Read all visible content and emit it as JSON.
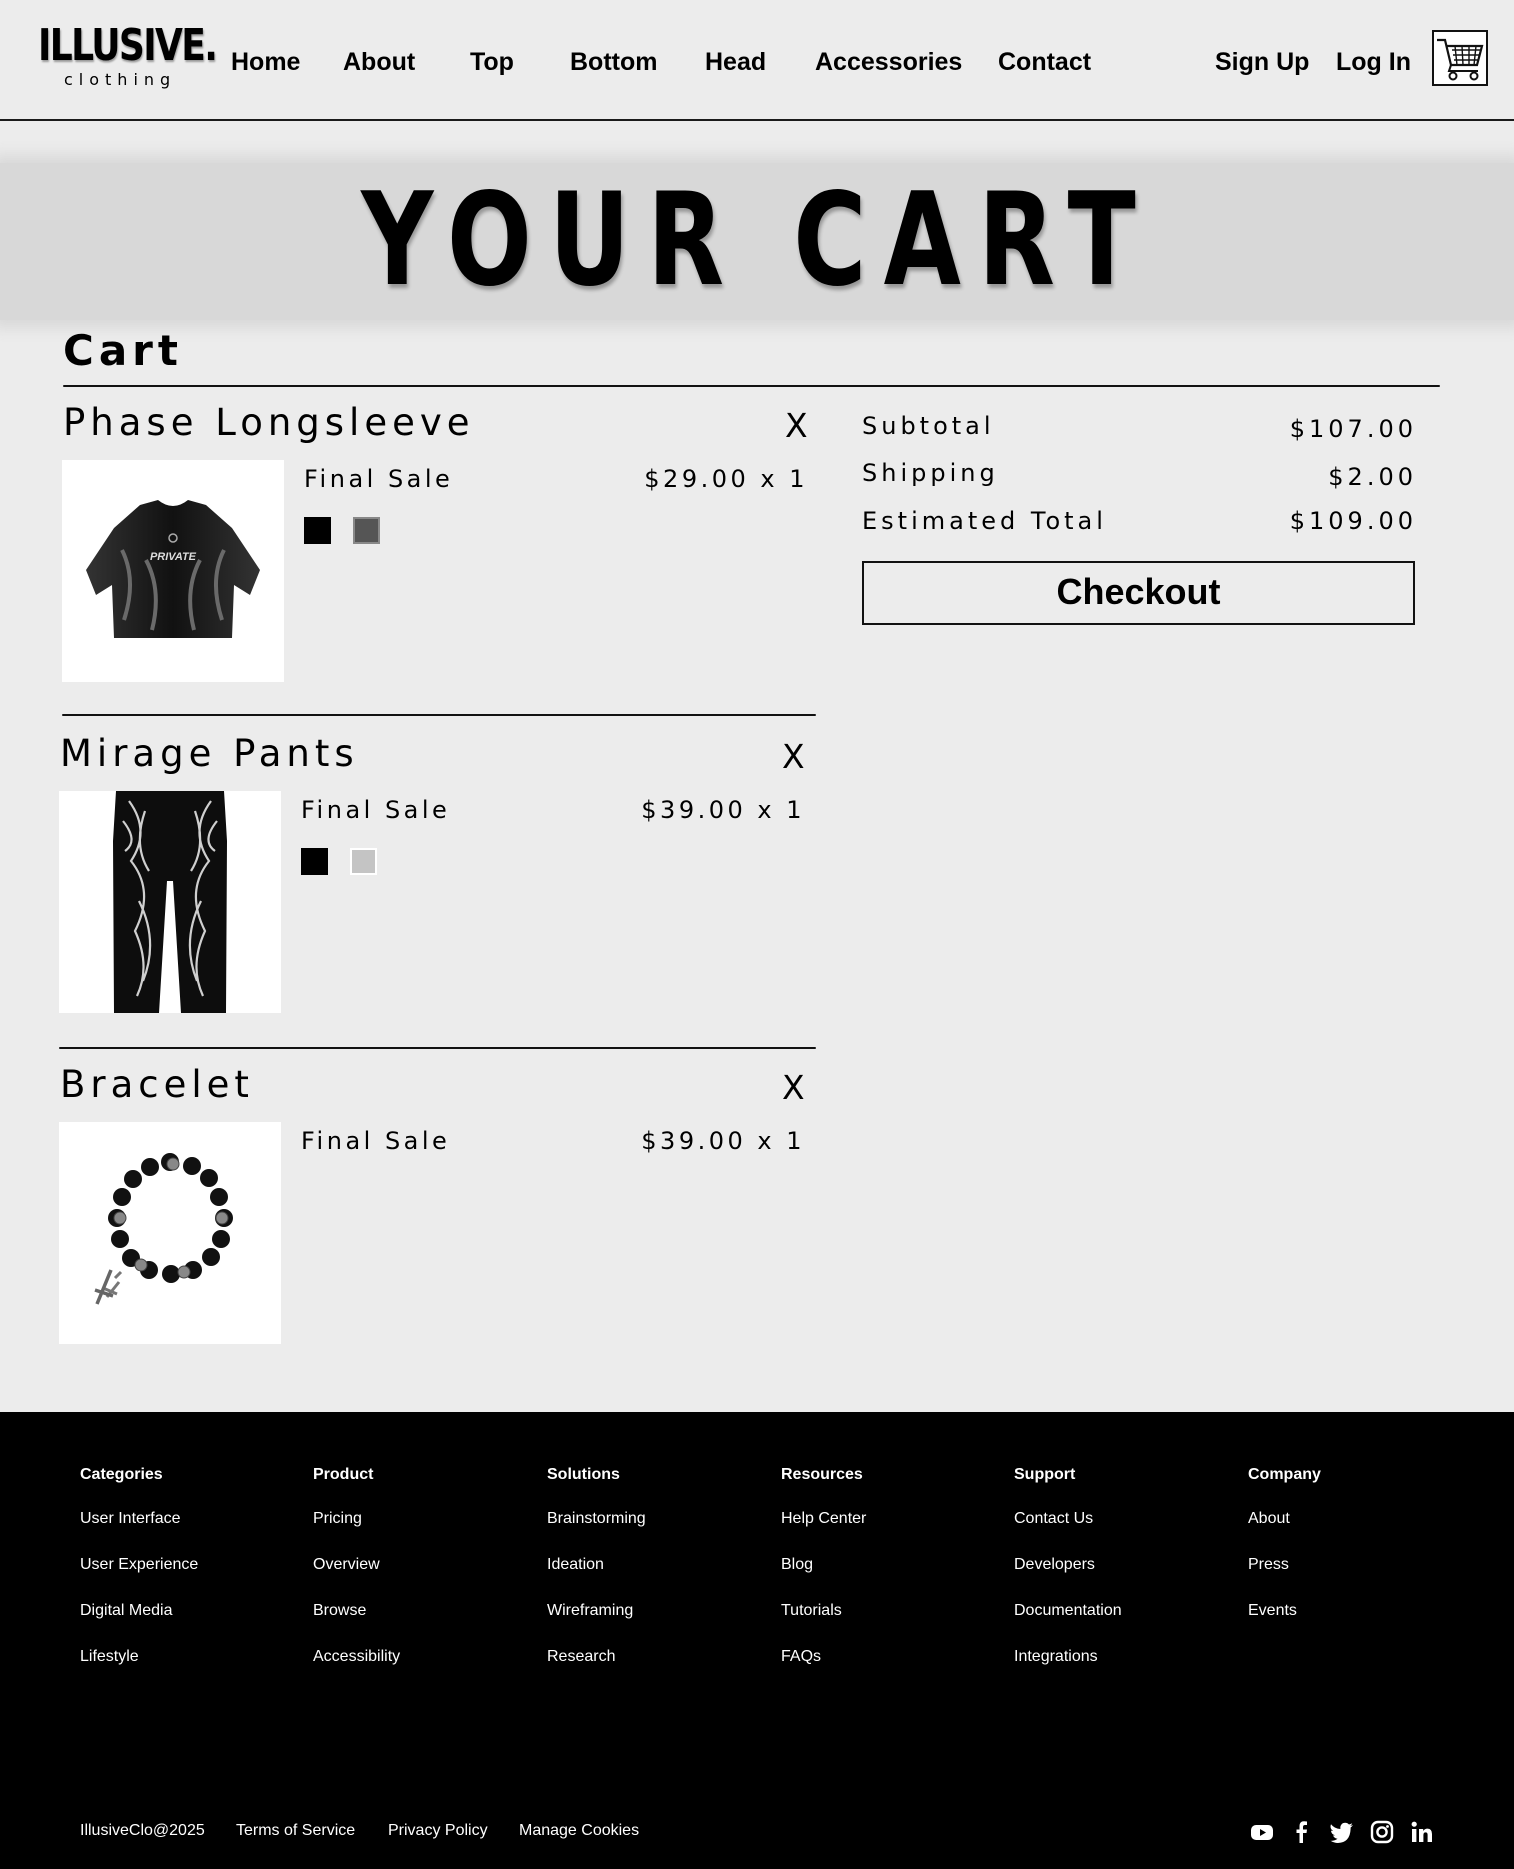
{
  "brand": {
    "name": "ILLUSIVE.",
    "tagline": "clothing"
  },
  "nav": {
    "items": [
      "Home",
      "About",
      "Top",
      "Bottom",
      "Head",
      "Accessories",
      "Contact"
    ],
    "sign_up": "Sign Up",
    "log_in": "Log In",
    "cart_icon": "shopping-cart-icon"
  },
  "banner": {
    "title": "YOUR CART"
  },
  "cart": {
    "heading": "Cart",
    "remove_label": "X",
    "items": [
      {
        "name": "Phase Longsleeve",
        "sale": "Final Sale",
        "price": "$29.00 x 1",
        "image": "black-longsleeve-shirt",
        "swatches": [
          "#000000",
          "#555555"
        ]
      },
      {
        "name": "Mirage Pants",
        "sale": "Final Sale",
        "price": "$39.00 x 1",
        "image": "black-graphic-pants",
        "swatches": [
          "#000000",
          "#c4c4c4"
        ]
      },
      {
        "name": "Bracelet",
        "sale": "Final Sale",
        "price": "$39.00 x 1",
        "image": "beaded-cross-bracelet",
        "swatches": []
      }
    ]
  },
  "summary": {
    "subtotal_label": "Subtotal",
    "subtotal_value": "$107.00",
    "shipping_label": "Shipping",
    "shipping_value": "$2.00",
    "total_label": "Estimated Total",
    "total_value": "$109.00",
    "checkout_label": "Checkout"
  },
  "footer": {
    "columns": [
      {
        "heading": "Categories",
        "links": [
          "User Interface",
          "User Experience",
          "Digital Media",
          "Lifestyle"
        ]
      },
      {
        "heading": "Product",
        "links": [
          "Pricing",
          "Overview",
          "Browse",
          "Accessibility"
        ]
      },
      {
        "heading": "Solutions",
        "links": [
          "Brainstorming",
          "Ideation",
          "Wireframing",
          "Research"
        ]
      },
      {
        "heading": "Resources",
        "links": [
          "Help Center",
          "Blog",
          "Tutorials",
          "FAQs"
        ]
      },
      {
        "heading": "Support",
        "links": [
          "Contact Us",
          "Developers",
          "Documentation",
          "Integrations"
        ]
      },
      {
        "heading": "Company",
        "links": [
          "About",
          "Press",
          "Events"
        ]
      }
    ],
    "copyright": "IllusiveClo@2025",
    "legal": [
      "Terms of Service",
      "Privacy Policy",
      "Manage Cookies"
    ],
    "social": [
      "youtube-icon",
      "facebook-icon",
      "twitter-icon",
      "instagram-icon",
      "linkedin-icon"
    ]
  }
}
